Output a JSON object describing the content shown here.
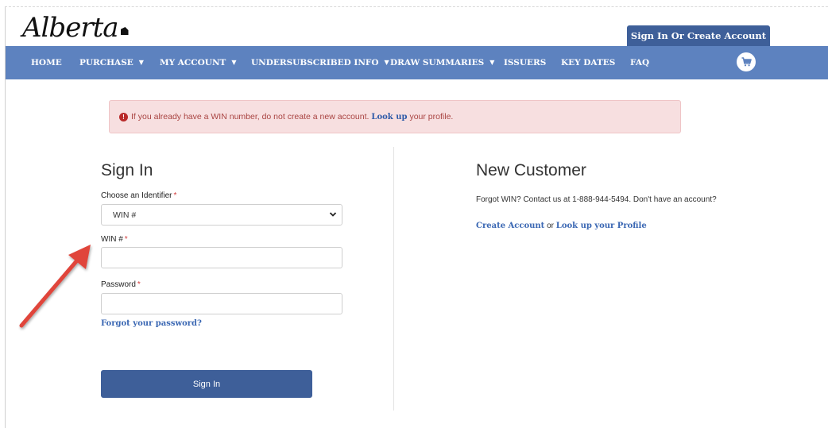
{
  "header": {
    "logo_text": "Alberta",
    "signin_button": "Sign In Or Create Account"
  },
  "nav": {
    "items": [
      {
        "label": "HOME",
        "dropdown": false
      },
      {
        "label": "PURCHASE",
        "dropdown": true
      },
      {
        "label": "MY ACCOUNT",
        "dropdown": true
      },
      {
        "label": "UNDERSUBSCRIBED INFO",
        "dropdown": true
      },
      {
        "label": "DRAW SUMMARIES",
        "dropdown": true
      },
      {
        "label": "ISSUERS",
        "dropdown": false
      },
      {
        "label": "KEY DATES",
        "dropdown": false
      },
      {
        "label": "FAQ",
        "dropdown": false
      }
    ],
    "caret": "▼",
    "cart_icon": "shopping-cart-icon"
  },
  "alert": {
    "text_before": "If you already have a WIN number, do not create a new account.",
    "link": "Look up",
    "text_after": "your profile."
  },
  "signin": {
    "title": "Sign In",
    "identifier_label": "Choose an Identifier",
    "identifier_value": "WIN #",
    "win_label": "WIN #",
    "win_value": "",
    "password_label": "Password",
    "password_value": "",
    "required_mark": "*",
    "forgot_link": "Forgot your password?",
    "submit_label": "Sign In"
  },
  "new_customer": {
    "title": "New Customer",
    "text": "Forgot WIN? Contact us at 1-888-944-5494. Don't have an account?",
    "create_link": "Create Account",
    "or_text": "or",
    "lookup_link": "Look up your Profile"
  },
  "colors": {
    "nav_bg": "#5d82bf",
    "button_bg": "#3e5f99",
    "alert_bg": "#f7dfe0",
    "alert_text": "#a94442",
    "link": "#3a67b3",
    "arrow": "#e0443a"
  }
}
